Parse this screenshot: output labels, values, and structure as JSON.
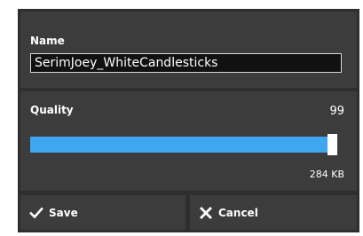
{
  "name": {
    "label": "Name",
    "value": "SerimJoey_WhiteCandlesticks"
  },
  "quality": {
    "label": "Quality",
    "value": "99",
    "slider_fraction": 0.99,
    "file_size": "284 KB"
  },
  "buttons": {
    "save_label": "Save",
    "save_icon": "checkmark-icon",
    "cancel_label": "Cancel",
    "cancel_icon": "x-icon"
  },
  "colors": {
    "dialog_bg": "#2e2e2e",
    "panel_bg": "#3c3c3c",
    "accent": "#3ea7ef"
  }
}
